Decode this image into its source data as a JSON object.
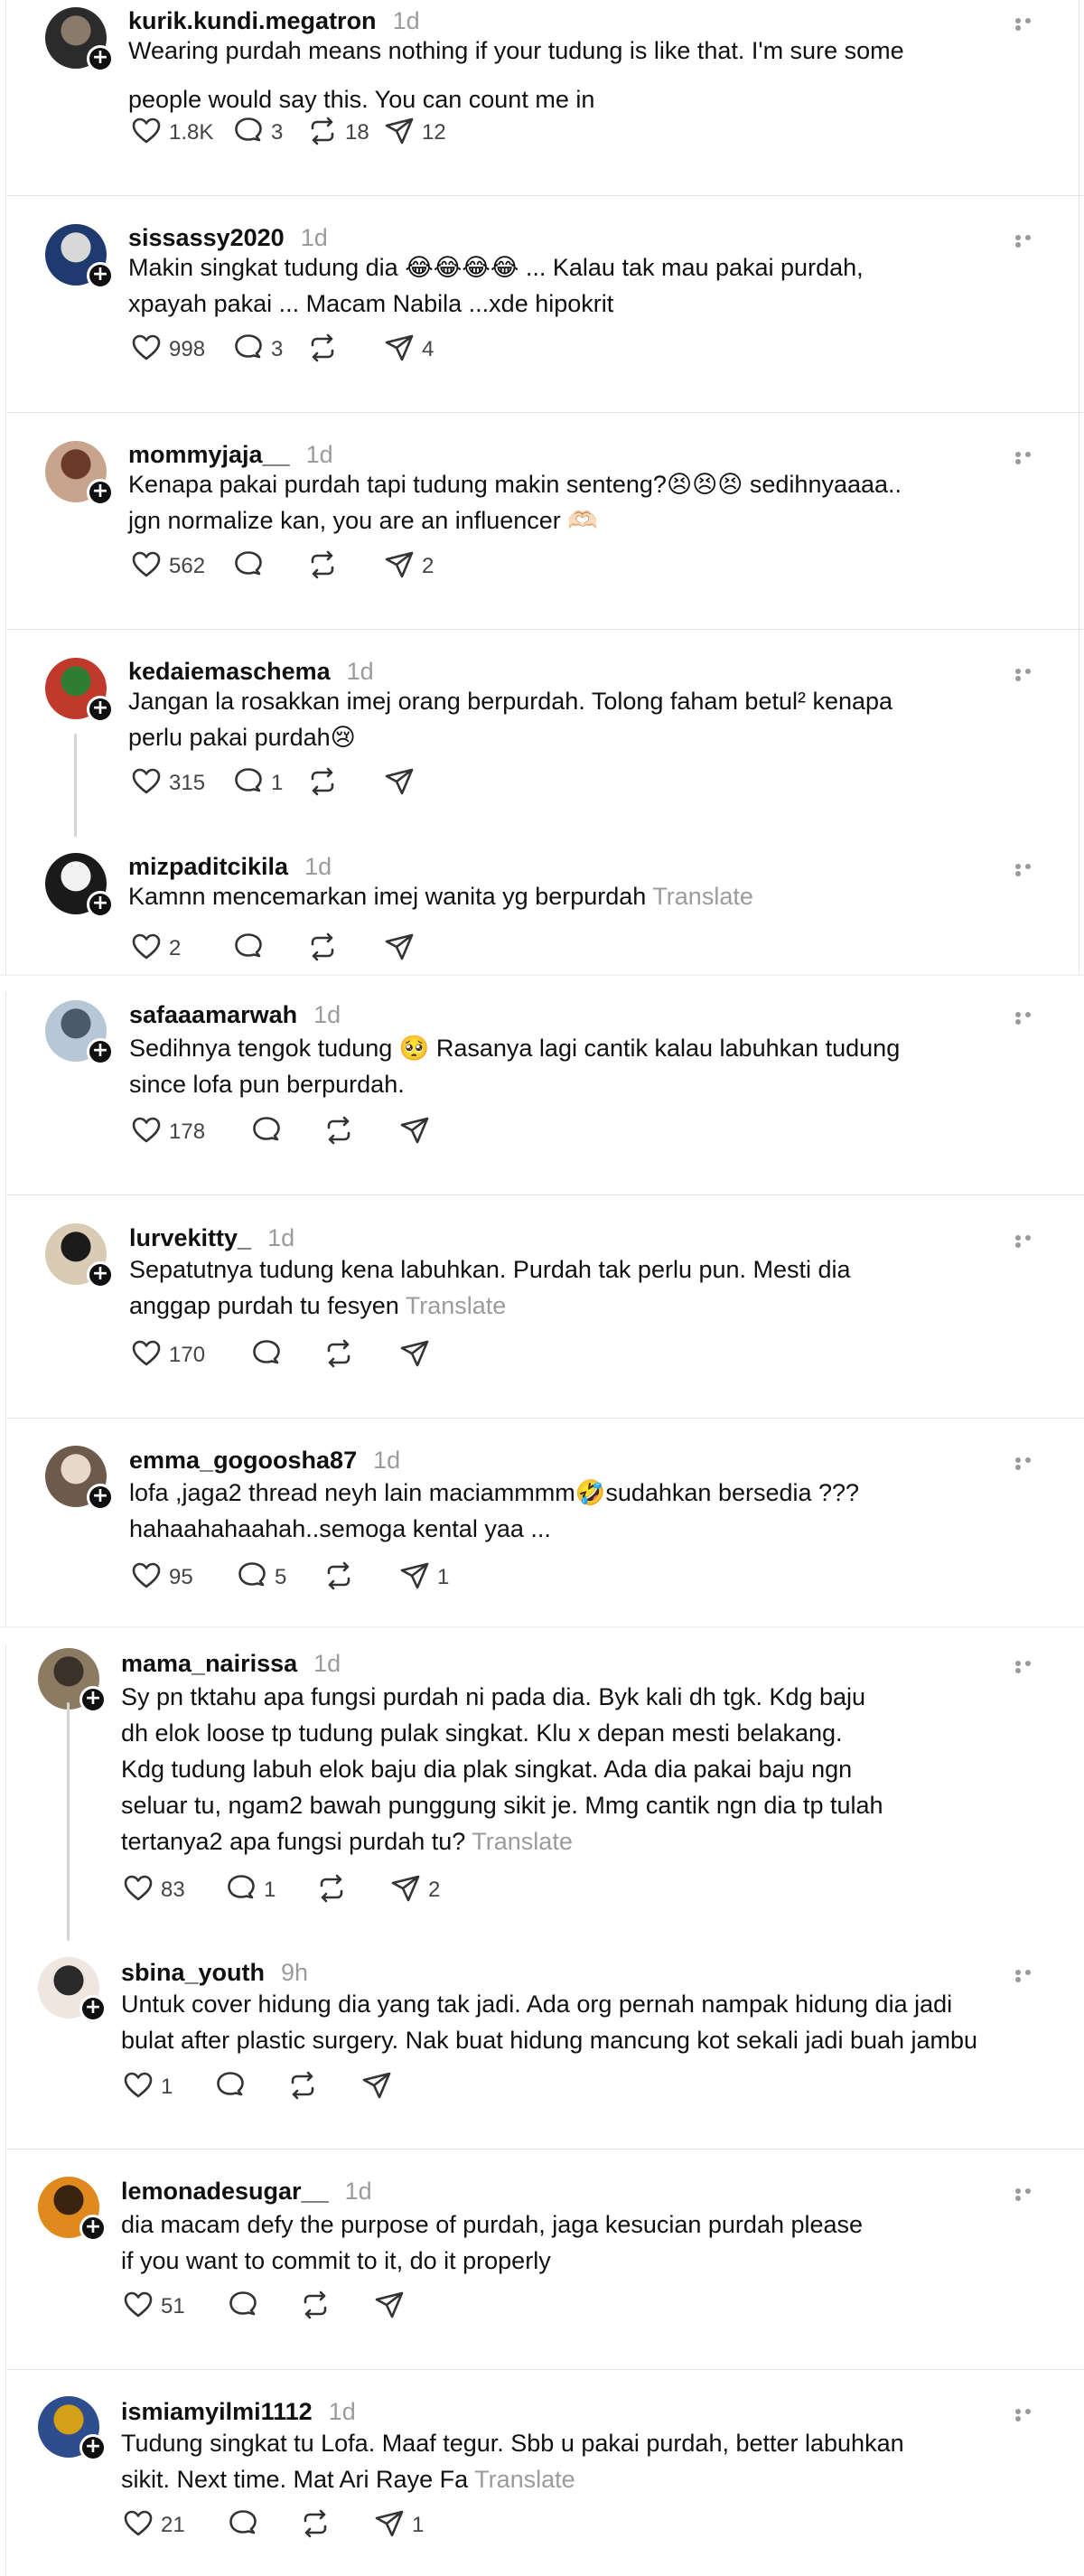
{
  "posts": [
    {
      "username": "kurik.kundi.megatron",
      "time": "1d",
      "lines": [
        "Wearing purdah means nothing if your tudung is like that. I'm sure some",
        "people would say this. You can count me in"
      ],
      "translate": "",
      "likes": "1.8K",
      "replies": "3",
      "reposts": "18",
      "shares": "12",
      "avatar_colors": [
        "#2b2b2b",
        "#8a7a6a"
      ]
    },
    {
      "username": "sissassy2020",
      "time": "1d",
      "lines": [
        "Makin singkat tudung dia 😂😂😂😂 ... Kalau tak mau pakai purdah,",
        "xpayah pakai ... Macam Nabila ...xde hipokrit"
      ],
      "translate": "",
      "likes": "998",
      "replies": "3",
      "reposts": "",
      "shares": "4",
      "avatar_colors": [
        "#1e3a6e",
        "#d8d8d8"
      ]
    },
    {
      "username": "mommyjaja__",
      "time": "1d",
      "lines": [
        "Kenapa pakai purdah tapi tudung makin senteng?😣😣😣 sedihnyaaaa..",
        "jgn normalize kan, you are an influencer 🫶🏻"
      ],
      "translate": "",
      "likes": "562",
      "replies": "",
      "reposts": "",
      "shares": "2",
      "avatar_colors": [
        "#c9a48c",
        "#6b3a2a"
      ]
    },
    {
      "username": "kedaiemaschema",
      "time": "1d",
      "lines": [
        "Jangan la rosakkan imej orang berpurdah. Tolong faham betul² kenapa",
        "perlu pakai purdah😢"
      ],
      "translate": "",
      "likes": "315",
      "replies": "1",
      "reposts": "",
      "shares": "",
      "avatar_colors": [
        "#c0392b",
        "#2e7d32"
      ]
    },
    {
      "username": "mizpaditcikila",
      "time": "1d",
      "lines": [
        "Kamnn mencemarkan imej wanita yg berpurdah "
      ],
      "translate": "Translate",
      "likes": "2",
      "replies": "",
      "reposts": "",
      "shares": "",
      "avatar_colors": [
        "#1a1a1a",
        "#f2f2f2"
      ]
    },
    {
      "username": "safaaamarwah",
      "time": "1d",
      "lines": [
        "Sedihnya tengok tudung 🥺 Rasanya lagi cantik kalau labuhkan tudung",
        "since lofa pun berpurdah."
      ],
      "translate": "",
      "likes": "178",
      "replies": "",
      "reposts": "",
      "shares": "",
      "avatar_colors": [
        "#b7c7d6",
        "#4a5a6a"
      ]
    },
    {
      "username": "lurvekitty_",
      "time": "1d",
      "lines": [
        "Sepatutnya tudung kena labuhkan. Purdah tak perlu pun. Mesti dia",
        "anggap purdah tu fesyen "
      ],
      "translate": "Translate",
      "likes": "170",
      "replies": "",
      "reposts": "",
      "shares": "",
      "avatar_colors": [
        "#d9cbb4",
        "#1b1b1b"
      ]
    },
    {
      "username": "emma_gogoosha87",
      "time": "1d",
      "lines": [
        "lofa ,jaga2 thread neyh lain maciammmm🤣sudahkan bersedia ???",
        "hahaahahaahah..semoga kental yaa ..."
      ],
      "translate": "",
      "likes": "95",
      "replies": "5",
      "reposts": "",
      "shares": "1",
      "avatar_colors": [
        "#6d5a4a",
        "#e8d8c8"
      ]
    },
    {
      "username": "mama_nairissa",
      "time": "1d",
      "lines": [
        "Sy pn tktahu apa fungsi purdah ni pada dia. Byk kali dh tgk. Kdg baju",
        "dh elok loose tp tudung pulak singkat. Klu x depan mesti belakang.",
        "Kdg tudung labuh elok baju dia plak singkat. Ada dia pakai baju ngn",
        "seluar tu, ngam2 bawah punggung sikit je. Mmg cantik ngn dia tp tulah",
        "tertanya2 apa fungsi purdah tu? "
      ],
      "translate": "Translate",
      "likes": "83",
      "replies": "1",
      "reposts": "",
      "shares": "2",
      "avatar_colors": [
        "#8c7a62",
        "#3a3228"
      ]
    },
    {
      "username": "sbina_youth",
      "time": "9h",
      "lines": [
        "Untuk cover hidung dia yang tak jadi. Ada org pernah nampak hidung dia jadi",
        "bulat after plastic surgery. Nak buat hidung mancung kot sekali jadi buah jambu"
      ],
      "translate": "",
      "likes": "1",
      "replies": "",
      "reposts": "",
      "shares": "",
      "avatar_colors": [
        "#f0e6e0",
        "#2a2a2a"
      ]
    },
    {
      "username": "lemonadesugar__",
      "time": "1d",
      "lines": [
        "dia macam defy the purpose of purdah, jaga kesucian purdah please",
        "if you want to commit to it, do it properly"
      ],
      "translate": "",
      "likes": "51",
      "replies": "",
      "reposts": "",
      "shares": "",
      "avatar_colors": [
        "#e08a1e",
        "#3a2410"
      ]
    },
    {
      "username": "ismiamyilmi1112",
      "time": "1d",
      "lines": [
        "Tudung singkat tu Lofa. Maaf tegur. Sbb u pakai purdah, better labuhkan",
        "sikit. Next time. Mat Ari Raye Fa "
      ],
      "translate": "Translate",
      "likes": "21",
      "replies": "",
      "reposts": "",
      "shares": "1",
      "avatar_colors": [
        "#2e4d8c",
        "#d4a017"
      ]
    }
  ],
  "icons": {
    "like": "heart-icon",
    "reply": "reply-bubble-icon",
    "repost": "repost-icon",
    "share": "share-send-icon",
    "more": "more-dots-icon"
  }
}
